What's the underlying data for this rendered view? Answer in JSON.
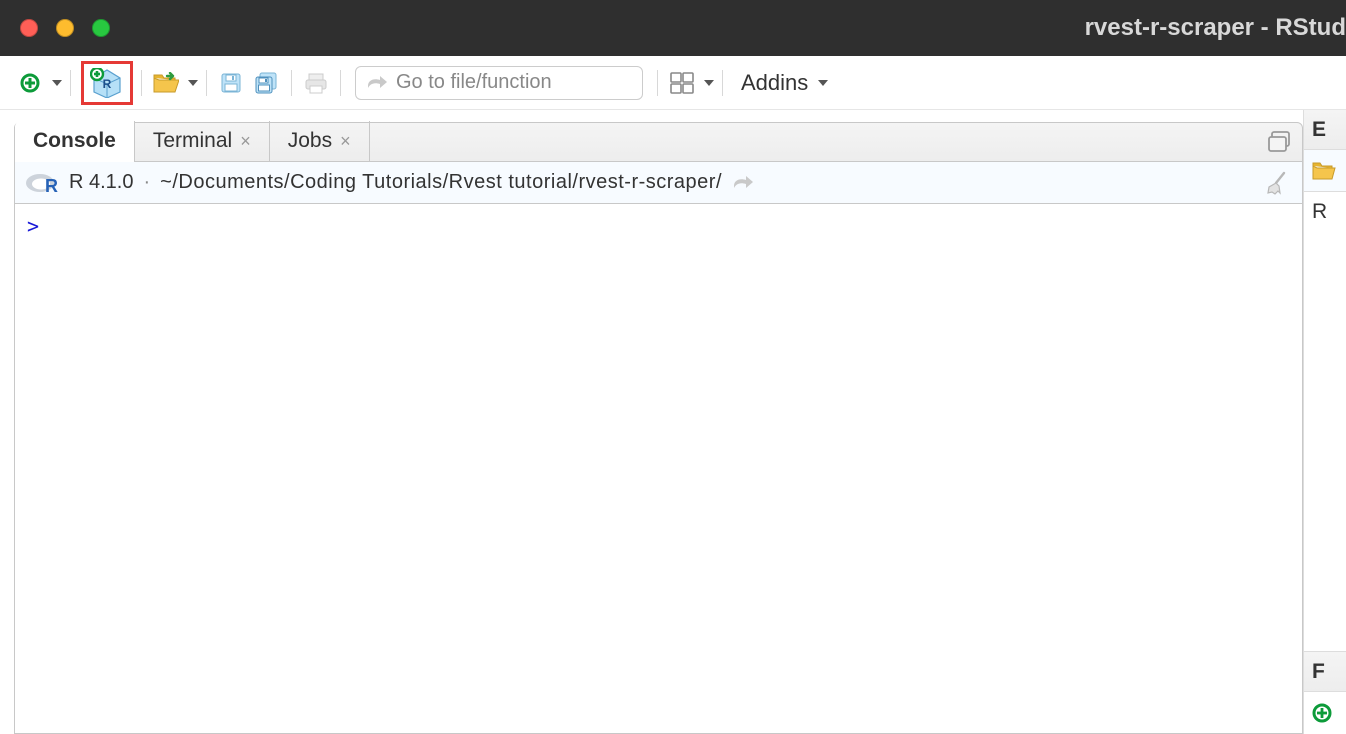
{
  "titlebar": {
    "title": "rvest-r-scraper - RStud"
  },
  "toolbar": {
    "goto_placeholder": "Go to file/function",
    "addins_label": "Addins"
  },
  "tabs": {
    "console": "Console",
    "terminal": "Terminal",
    "jobs": "Jobs"
  },
  "console": {
    "r_version": "R 4.1.0",
    "separator": "·",
    "working_dir": "~/Documents/Coding Tutorials/Rvest tutorial/rvest-r-scraper/",
    "prompt": ">"
  },
  "right": {
    "env_initial": "E",
    "r_initial": "R",
    "files_initial": "F"
  }
}
